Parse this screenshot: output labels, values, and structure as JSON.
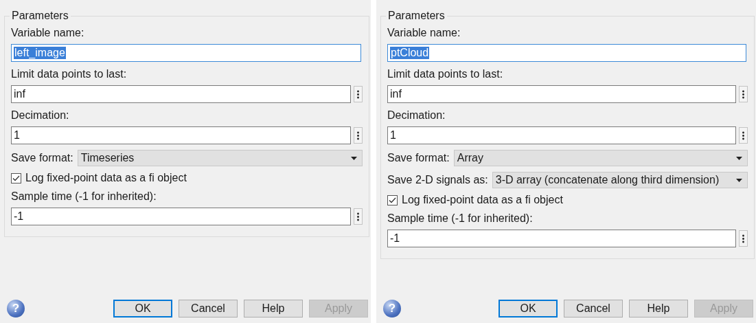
{
  "dialogs": [
    {
      "group_title": "Parameters",
      "rows": [
        {
          "kind": "text",
          "label": "Variable name:",
          "value": "left_image",
          "text_selected": true,
          "more_button": false
        },
        {
          "kind": "text",
          "label": "Limit data points to last:",
          "value": "inf",
          "text_selected": false,
          "more_button": true
        },
        {
          "kind": "text",
          "label": "Decimation:",
          "value": "1",
          "text_selected": false,
          "more_button": true
        },
        {
          "kind": "dropdown",
          "label": "Save format:",
          "value": "Timeseries"
        },
        {
          "kind": "checkbox",
          "label": "Log fixed-point data as a fi object",
          "checked": true
        },
        {
          "kind": "text",
          "label": "Sample time (-1 for inherited):",
          "value": "-1",
          "text_selected": false,
          "more_button": true
        }
      ],
      "help_symbol": "?",
      "buttons": [
        {
          "label": "OK",
          "default": true,
          "disabled": false
        },
        {
          "label": "Cancel",
          "default": false,
          "disabled": false
        },
        {
          "label": "Help",
          "default": false,
          "disabled": false
        },
        {
          "label": "Apply",
          "default": false,
          "disabled": true
        }
      ]
    },
    {
      "group_title": "Parameters",
      "rows": [
        {
          "kind": "text",
          "label": "Variable name:",
          "value": "ptCloud",
          "text_selected": true,
          "more_button": false
        },
        {
          "kind": "text",
          "label": "Limit data points to last:",
          "value": "inf",
          "text_selected": false,
          "more_button": true
        },
        {
          "kind": "text",
          "label": "Decimation:",
          "value": "1",
          "text_selected": false,
          "more_button": true
        },
        {
          "kind": "dropdown",
          "label": "Save format:",
          "value": "Array"
        },
        {
          "kind": "dropdown",
          "label": "Save 2-D signals as:",
          "value": "3-D array (concatenate along third dimension)"
        },
        {
          "kind": "checkbox",
          "label": "Log fixed-point data as a fi object",
          "checked": true
        },
        {
          "kind": "text",
          "label": "Sample time (-1 for inherited):",
          "value": "-1",
          "text_selected": false,
          "more_button": true
        }
      ],
      "help_symbol": "?",
      "buttons": [
        {
          "label": "OK",
          "default": true,
          "disabled": false
        },
        {
          "label": "Cancel",
          "default": false,
          "disabled": false
        },
        {
          "label": "Help",
          "default": false,
          "disabled": false
        },
        {
          "label": "Apply",
          "default": false,
          "disabled": true
        }
      ]
    }
  ]
}
